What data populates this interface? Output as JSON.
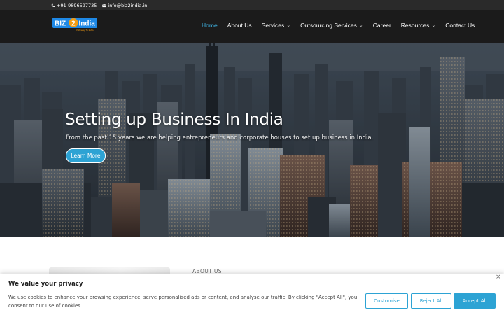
{
  "topbar": {
    "phone": "+91-9896597735",
    "email": "info@biz2india.in"
  },
  "logo": {
    "text_left": "BIZ",
    "text_num": "2",
    "text_right": "India",
    "tagline": "Gateway To India",
    "colors": {
      "blue": "#1e88e5",
      "orange": "#f39c12"
    }
  },
  "nav": {
    "items": [
      {
        "label": "Home",
        "active": true,
        "dropdown": false
      },
      {
        "label": "About Us",
        "active": false,
        "dropdown": false
      },
      {
        "label": "Services",
        "active": false,
        "dropdown": true
      },
      {
        "label": "Outsourcing Services",
        "active": false,
        "dropdown": true
      },
      {
        "label": "Career",
        "active": false,
        "dropdown": false
      },
      {
        "label": "Resources",
        "active": false,
        "dropdown": true
      },
      {
        "label": "Contact Us",
        "active": false,
        "dropdown": false
      }
    ],
    "chevron": "⌄"
  },
  "hero": {
    "title": "Setting up Business In India",
    "subtitle": "From the past 15 years we are helping entrepreneurs and corporate houses to set up business in India.",
    "button_label": "Learn More"
  },
  "about": {
    "label": "ABOUT US"
  },
  "cookie": {
    "title": "We value your privacy",
    "text": "We use cookies to enhance your browsing experience, serve personalised ads or content, and analyse our traffic. By clicking \"Accept All\", you consent to our use of cookies.",
    "customise_label": "Customise",
    "reject_label": "Reject All",
    "accept_label": "Accept All",
    "close_label": "×"
  },
  "colors": {
    "accent": "#2da3d4",
    "nav_active": "#3fb5e6",
    "header_bg": "#1b1b1b",
    "topbar_bg": "#2a2a2a"
  }
}
